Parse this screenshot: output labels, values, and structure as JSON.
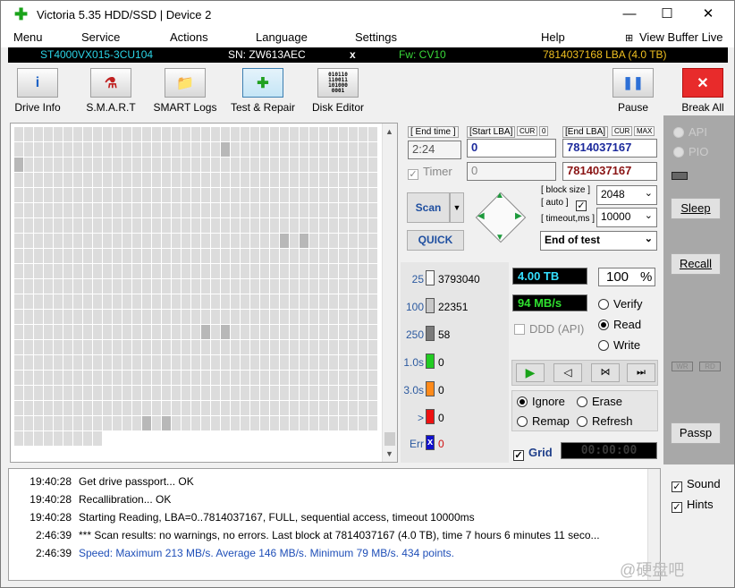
{
  "window": {
    "title": "Victoria 5.35 HDD/SSD | Device 2",
    "min": "—",
    "max": "☐",
    "close": "✕"
  },
  "menu": [
    "Menu",
    "Service",
    "Actions",
    "Language",
    "Settings",
    "Help"
  ],
  "view_buffer": "View Buffer Live",
  "info": {
    "model": "ST4000VX015-3CU104",
    "sn": "SN: ZW613AEC",
    "x": "x",
    "fw": "Fw: CV10",
    "lba": "7814037168 LBA (4.0 TB)"
  },
  "toolbar": {
    "drive_info": "Drive Info",
    "smart": "S.M.A.R.T",
    "smart_logs": "SMART Logs",
    "test_repair": "Test & Repair",
    "disk_editor": "Disk Editor",
    "pause": "Pause",
    "break_all": "Break All",
    "disk_editor_icon_text": "010110\n110011\n101000\n0001"
  },
  "controls": {
    "end_time_lbl": "[ End time ]",
    "end_time": "2:24",
    "start_lba_lbl": "[Start LBA]",
    "cur": "CUR",
    "zero": "0",
    "end_lba_lbl": "[End LBA]",
    "max": "MAX",
    "start_lba": "0",
    "end_lba": "7814037167",
    "timer_lbl": "Timer",
    "timer_val": "0",
    "end_lba2": "7814037167",
    "scan": "Scan",
    "quick": "QUICK",
    "block_size_lbl": "[ block size ]",
    "auto_lbl": "[ auto ]",
    "timeout_lbl": "[ timeout,ms ]",
    "block_size": "2048",
    "timeout": "10000",
    "end_of_test": "End of test"
  },
  "stats": [
    {
      "label": "25",
      "count": "3793040",
      "color": "#f8f8f8"
    },
    {
      "label": "100",
      "count": "22351",
      "color": "#c8c8c8"
    },
    {
      "label": "250",
      "count": "58",
      "color": "#7a7a7a"
    },
    {
      "label": "1.0s",
      "count": "0",
      "color": "#22cc22"
    },
    {
      "label": "3.0s",
      "count": "0",
      "color": "#ff8a1a"
    },
    {
      "label": ">",
      "count": "0",
      "color": "#ee1111"
    },
    {
      "label": "Err",
      "count": "0",
      "color": "#1010cc"
    }
  ],
  "readout": {
    "size": "4.00 TB",
    "pct": "100",
    "pct_sign": "%",
    "speed": "94 MB/s",
    "verify": "Verify",
    "read": "Read",
    "write": "Write",
    "ddd": "DDD (API)",
    "ignore": "Ignore",
    "erase": "Erase",
    "remap": "Remap",
    "refresh": "Refresh",
    "grid": "Grid",
    "clock": "00:00:00"
  },
  "side": {
    "api": "API",
    "pio": "PIO",
    "sleep": "Sleep",
    "recall": "Recall",
    "wr": "WR",
    "rd": "RD",
    "passp": "Passp"
  },
  "log": [
    {
      "time": "19:40:28",
      "msg": "Get drive passport... OK",
      "blue": false
    },
    {
      "time": "19:40:28",
      "msg": "Recallibration... OK",
      "blue": false
    },
    {
      "time": "19:40:28",
      "msg": "Starting Reading, LBA=0..7814037167, FULL, sequential access, timeout 10000ms",
      "blue": false
    },
    {
      "time": "2:46:39",
      "msg": "*** Scan results: no warnings, no errors. Last block at 7814037167 (4.0 TB), time 7 hours 6 minutes 11 seco...",
      "blue": false
    },
    {
      "time": "2:46:39",
      "msg": "Speed: Maximum 213 MB/s. Average 146 MB/s. Minimum 79 MB/s. 434 points.",
      "blue": true
    }
  ],
  "options": {
    "sound": "Sound",
    "hints": "Hints"
  },
  "watermark": "@硬盘吧"
}
